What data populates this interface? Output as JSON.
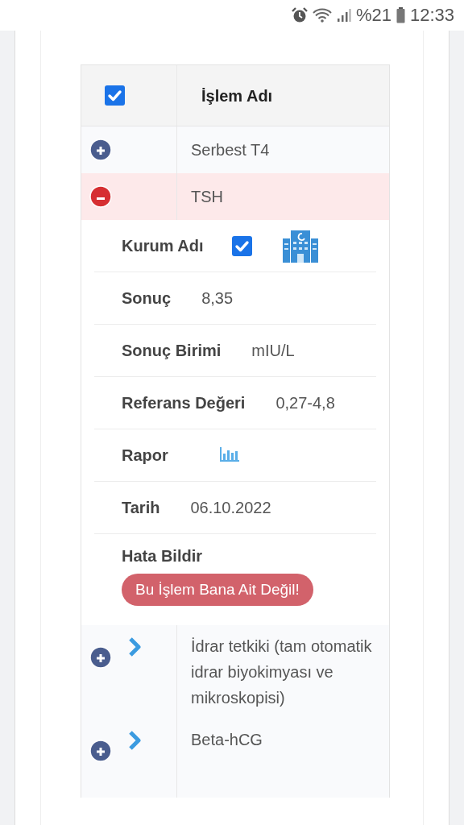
{
  "status_bar": {
    "battery": "%21",
    "time": "12:33"
  },
  "table": {
    "header_checkbox": {
      "checked": true
    },
    "header": "İşlem Adı",
    "rows": [
      {
        "name": "Serbest T4",
        "kind": "basic",
        "expanded": false
      },
      {
        "name": "TSH",
        "kind": "basic",
        "expanded": true,
        "details": [
          {
            "kind": "institution",
            "label": "Kurum Adı",
            "checked": true
          },
          {
            "kind": "text",
            "label": "Sonuç",
            "value": "8,35"
          },
          {
            "kind": "text",
            "label": "Sonuç Birimi",
            "value": "mIU/L"
          },
          {
            "kind": "text",
            "label": "Referans Değeri",
            "value": "0,27-4,8"
          },
          {
            "kind": "report",
            "label": "Rapor"
          },
          {
            "kind": "text",
            "label": "Tarih",
            "value": "06.10.2022"
          },
          {
            "kind": "action",
            "label": "Hata Bildir",
            "button": "Bu İşlem Bana Ait Değil!"
          }
        ]
      },
      {
        "name": "İdrar tetkiki (tam otomatik idrar biyokimyası ve mikroskopisi)",
        "kind": "chevron",
        "expanded": false
      },
      {
        "name": "Beta-hCG",
        "kind": "chevron",
        "expanded": false
      }
    ]
  }
}
